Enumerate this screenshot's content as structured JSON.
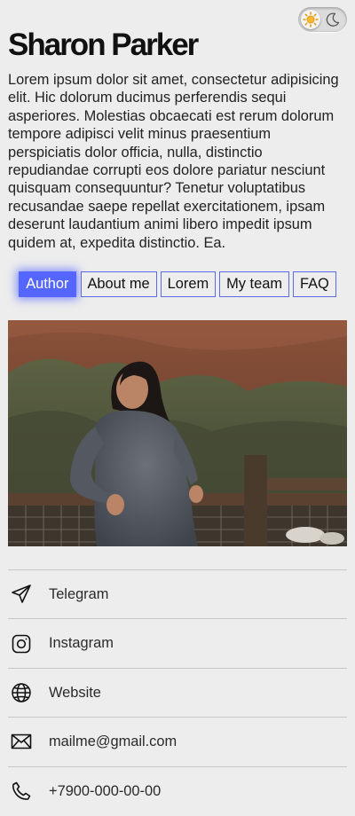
{
  "theme_toggle": {
    "sun_icon": "sun-icon",
    "moon_icon": "moon-icon",
    "state": "light"
  },
  "profile": {
    "name": "Sharon Parker",
    "bio": "Lorem ipsum dolor sit amet, consectetur adipisicing elit. Hic dolorum ducimus perferendis sequi asperiores. Molestias obcaecati est rerum dolorum tempore adipisci velit minus praesentium perspiciatis dolor officia, nulla, distinctio repudiandae corrupti eos dolore pariatur nesciunt quisquam consequuntur? Tenetur voluptatibus recusandae saepe repellat exercitationem, ipsam deserunt laudantium animi libero impedit ipsum quidem at, expedita distinctio. Ea."
  },
  "tabs": [
    {
      "label": "Author",
      "active": true
    },
    {
      "label": "About me",
      "active": false
    },
    {
      "label": "Lorem",
      "active": false
    },
    {
      "label": "My team",
      "active": false
    },
    {
      "label": "FAQ",
      "active": false
    }
  ],
  "contacts": [
    {
      "label": "Telegram",
      "icon": "telegram-icon"
    },
    {
      "label": "Instagram",
      "icon": "instagram-icon"
    },
    {
      "label": "Website",
      "icon": "globe-icon"
    },
    {
      "label": "mailme@gmail.com",
      "icon": "mail-icon"
    },
    {
      "label": "+7900-000-00-00",
      "icon": "phone-icon"
    }
  ],
  "colors": {
    "accent": "#5466ff",
    "background": "#ededed",
    "divider": "#c8c8c8",
    "sun": "#f5a623"
  }
}
